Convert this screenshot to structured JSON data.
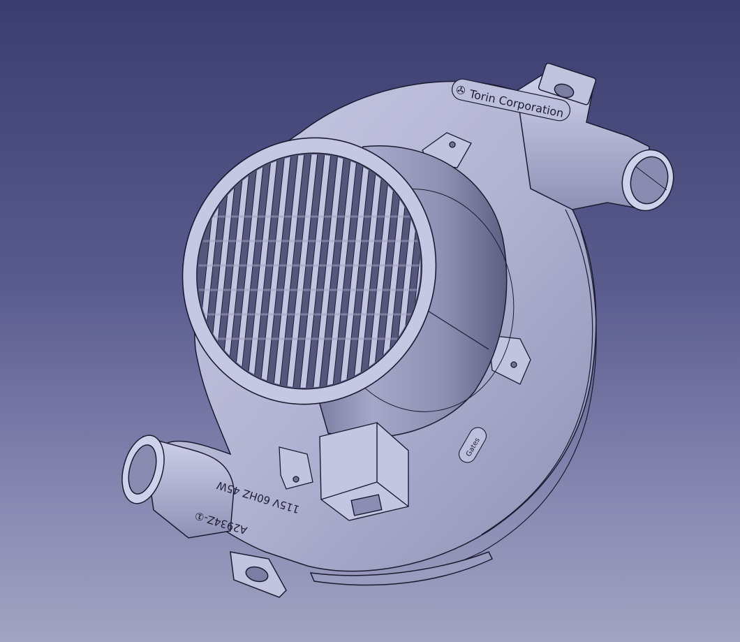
{
  "viewport": {
    "background_top": "#3b3d6f",
    "background_bottom": "#a3a3c2",
    "model_color": "#b7b8d6",
    "edge_color": "#1a1b30"
  },
  "model": {
    "label_brand": "Torin Corporation",
    "label_rating": "115V 60HZ 45W",
    "label_part": "A2934Z-①",
    "label_small": "Gates",
    "logo_icon": "fan-logo-icon"
  }
}
